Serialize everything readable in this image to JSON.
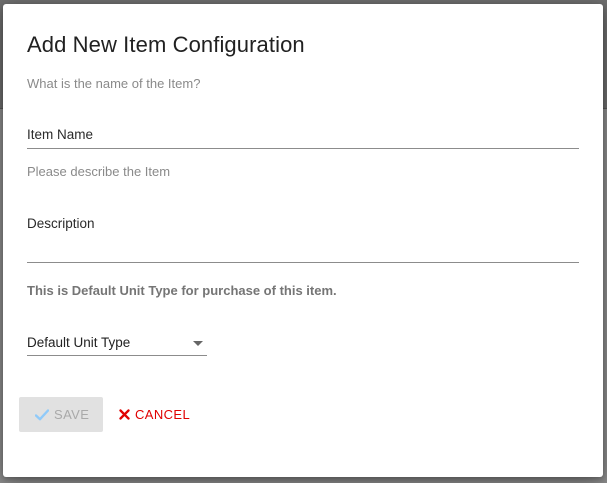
{
  "dialog": {
    "title": "Add New Item Configuration",
    "item_name": {
      "helper": "What is the name of the Item?",
      "label": "Item Name",
      "value": ""
    },
    "description": {
      "helper": "Please describe the Item",
      "label": "Description",
      "value": ""
    },
    "unit_type": {
      "helper": "This is Default Unit Type for purchase of this item.",
      "selected": "Default Unit Type"
    },
    "actions": {
      "save_label": "SAVE",
      "save_icon": "check-icon",
      "save_enabled": false,
      "cancel_label": "CANCEL",
      "cancel_icon": "close-icon"
    }
  },
  "colors": {
    "cancel": "#e00000",
    "save_icon": "#90caf9",
    "save_disabled_bg": "#e1e1e1"
  }
}
